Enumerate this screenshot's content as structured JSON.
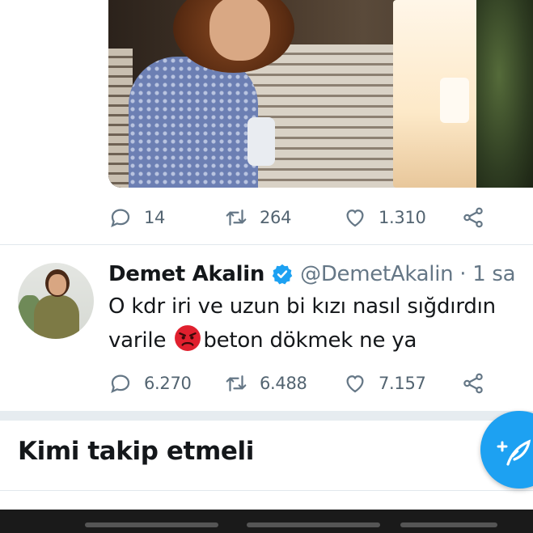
{
  "tweet1": {
    "media": "photo",
    "actions": {
      "reply_count": "14",
      "retweet_count": "264",
      "like_count": "1.310"
    }
  },
  "tweet2": {
    "author_name": "Demet Akalin",
    "handle_time": "@DemetAkalin · 1 sa",
    "text_line1": "O kdr iri ve uzun bi kızı nasıl sığdırdın",
    "text_line2_before": "varile ",
    "text_line2_emoji": "angry-face-emoji",
    "text_line2_after": "beton dökmek ne ya",
    "actions": {
      "reply_count": "6.270",
      "retweet_count": "6.488",
      "like_count": "7.157"
    }
  },
  "section": {
    "title": "Kimi takip etmeli"
  },
  "colors": {
    "accent": "#1da1f2",
    "icon_gray": "#657786",
    "divider": "#e1e8ed"
  }
}
